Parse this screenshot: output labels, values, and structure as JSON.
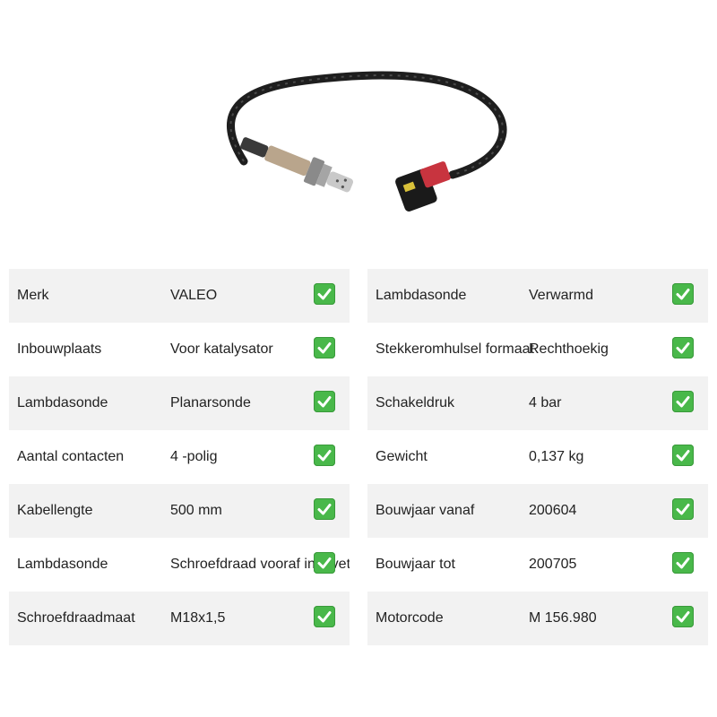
{
  "product": {
    "image_icon": "lambda-sensor-photo"
  },
  "specs_left": [
    {
      "label": "Merk",
      "value": "VALEO"
    },
    {
      "label": "Inbouwplaats",
      "value": "Voor katalysator"
    },
    {
      "label": "Lambdasonde",
      "value": "Planarsonde"
    },
    {
      "label": "Aantal contacten",
      "value": "4 -polig"
    },
    {
      "label": "Kabellengte",
      "value": "500 mm"
    },
    {
      "label": "Lambdasonde",
      "value": "Schroefdraad vooraf ingevet"
    },
    {
      "label": "Schroefdraadmaat",
      "value": "M18x1,5"
    }
  ],
  "specs_right": [
    {
      "label": "Lambdasonde",
      "value": "Verwarmd"
    },
    {
      "label": "Stekkeromhulsel formaat",
      "value": "Rechthoekig"
    },
    {
      "label": "Schakeldruk",
      "value": "4 bar"
    },
    {
      "label": "Gewicht",
      "value": "0,137 kg"
    },
    {
      "label": "Bouwjaar vanaf",
      "value": "200604"
    },
    {
      "label": "Bouwjaar tot",
      "value": "200705"
    },
    {
      "label": "Motorcode",
      "value": "M 156.980"
    }
  ],
  "colors": {
    "row_shade": "#f2f2f2",
    "check": "#49b84a"
  },
  "icons": {
    "check": "check-mark-icon"
  }
}
